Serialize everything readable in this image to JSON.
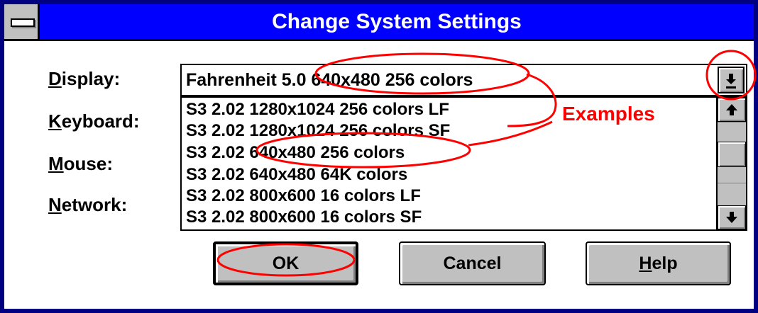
{
  "window": {
    "title": "Change System Settings"
  },
  "labels": {
    "display": {
      "mnemonic": "D",
      "rest": "isplay:"
    },
    "keyboard": {
      "mnemonic": "K",
      "rest": "eyboard:"
    },
    "mouse": {
      "mnemonic": "M",
      "rest": "ouse:"
    },
    "network": {
      "mnemonic": "N",
      "rest": "etwork:"
    }
  },
  "display_combo": {
    "selected_value": "Fahrenheit 5.0 640x480 256 colors",
    "options": [
      "S3 2.02 1280x1024 256 colors LF",
      "S3 2.02 1280x1024 256 colors SF",
      "S3 2.02 640x480 256 colors",
      "S3 2.02 640x480 64K colors",
      "S3 2.02 800x600 16 colors LF",
      "S3 2.02 800x600 16 colors SF"
    ]
  },
  "buttons": {
    "ok": "OK",
    "cancel": "Cancel",
    "help": {
      "mnemonic": "H",
      "rest": "elp"
    }
  },
  "annotation": {
    "label": "Examples",
    "color": "#ff0000"
  },
  "colors": {
    "titlebar": "#0000ff",
    "frame": "#000080",
    "face": "#c0c0c0"
  }
}
